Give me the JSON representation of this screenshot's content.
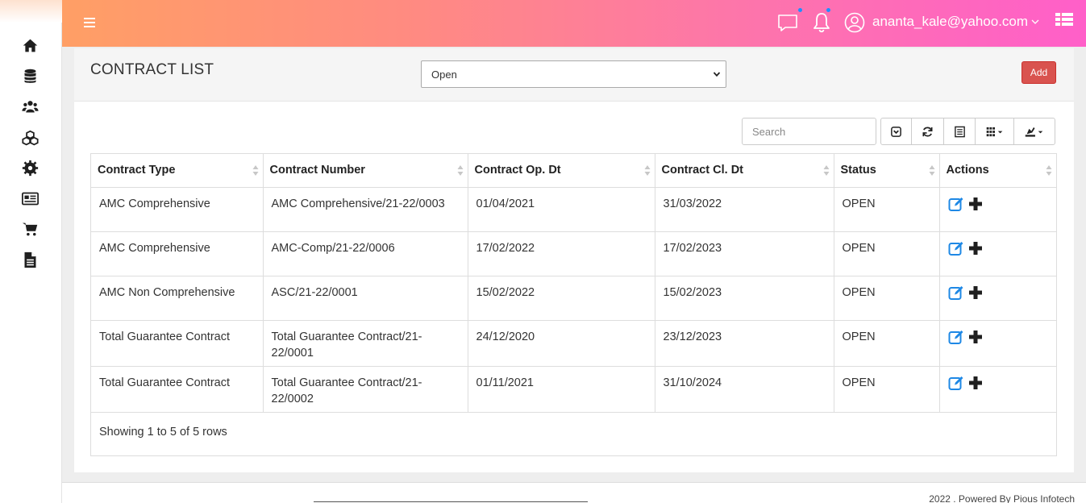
{
  "header": {
    "user_email": "ananta_kale@yahoo.com"
  },
  "sidebar": {
    "items": [
      {
        "icon": "home-icon"
      },
      {
        "icon": "database-icon"
      },
      {
        "icon": "users-icon"
      },
      {
        "icon": "cubes-icon"
      },
      {
        "icon": "gear-icon"
      },
      {
        "icon": "newspaper-icon"
      },
      {
        "icon": "cart-icon"
      },
      {
        "icon": "document-icon"
      }
    ]
  },
  "page": {
    "title": "CONTRACT LIST",
    "status_filter": "Open",
    "status_options": [
      "Open"
    ],
    "add_label": "Add"
  },
  "toolbar": {
    "search_placeholder": "Search"
  },
  "table": {
    "columns": [
      "Contract Type",
      "Contract Number",
      "Contract Op. Dt",
      "Contract Cl. Dt",
      "Status",
      "Actions"
    ],
    "rows": [
      {
        "type": "AMC Comprehensive",
        "number": "AMC Comprehensive/21-22/0003",
        "op": "01/04/2021",
        "cl": "31/03/2022",
        "status": "OPEN"
      },
      {
        "type": "AMC Comprehensive",
        "number": "AMC-Comp/21-22/0006",
        "op": "17/02/2022",
        "cl": "17/02/2023",
        "status": "OPEN"
      },
      {
        "type": "AMC Non Comprehensive",
        "number": "ASC/21-22/0001",
        "op": "15/02/2022",
        "cl": "15/02/2023",
        "status": "OPEN"
      },
      {
        "type": "Total Guarantee Contract",
        "number": "Total Guarantee Contract/21-22/0001",
        "op": "24/12/2020",
        "cl": "23/12/2023",
        "status": "OPEN"
      },
      {
        "type": "Total Guarantee Contract",
        "number": "Total Guarantee Contract/21-22/0002",
        "op": "01/11/2021",
        "cl": "31/10/2024",
        "status": "OPEN"
      }
    ],
    "summary": "Showing 1 to 5 of 5 rows"
  },
  "footer": {
    "text": "2022 . Powered By Pious Infotech"
  },
  "colors": {
    "header_start": "#ff9f65",
    "header_end": "#ff5fc9",
    "add_button": "#d9534f",
    "edit_icon": "#1e88e5"
  }
}
